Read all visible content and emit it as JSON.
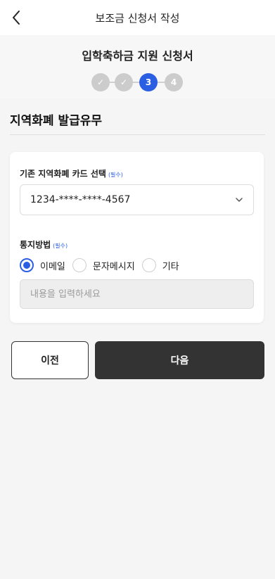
{
  "header": {
    "title": "보조금 신청서 작성",
    "back_icon": "chevron-left-icon"
  },
  "form": {
    "title": "입학축하금 지원 신청서",
    "steps": [
      {
        "label": "✓",
        "state": "done"
      },
      {
        "label": "✓",
        "state": "done"
      },
      {
        "label": "3",
        "state": "current"
      },
      {
        "label": "4",
        "state": "upcoming"
      }
    ]
  },
  "section": {
    "title": "지역화폐 발급유무"
  },
  "card": {
    "card_select": {
      "label": "기존 지역화폐 카드 선택",
      "required": "(필수)",
      "value": "1234-****-****-4567"
    },
    "notify": {
      "label": "통지방법",
      "required": "(필수)",
      "options": [
        {
          "label": "이메일",
          "checked": true
        },
        {
          "label": "문자메시지",
          "checked": false
        },
        {
          "label": "기타",
          "checked": false
        }
      ],
      "placeholder": "내용을 입력하세요"
    }
  },
  "buttons": {
    "prev": "이전",
    "next": "다음"
  },
  "colors": {
    "accent": "#2b5fe3",
    "primary_button": "#333333",
    "background": "#f5f5f5"
  }
}
